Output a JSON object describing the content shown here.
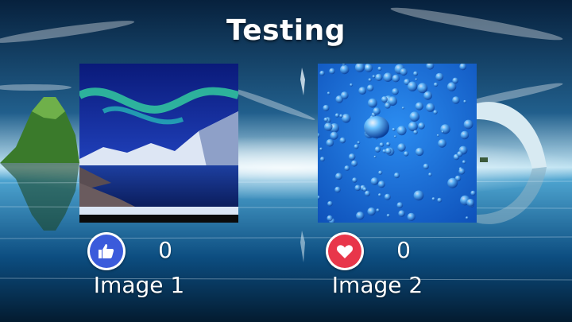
{
  "title": "Testing",
  "cards": [
    {
      "caption": "Image 1",
      "count": "0",
      "reaction_icon": "thumbs-up-icon",
      "reaction_color": "#3b5bdb",
      "image_subject": "aurora-over-mountain-lake"
    },
    {
      "caption": "Image 2",
      "count": "0",
      "reaction_icon": "heart-icon",
      "reaction_color": "#e8364a",
      "image_subject": "water-droplets-on-blue"
    }
  ],
  "colors": {
    "text": "#ffffff",
    "sky_top": "#0b2f55",
    "water": "#1b6fa2"
  }
}
